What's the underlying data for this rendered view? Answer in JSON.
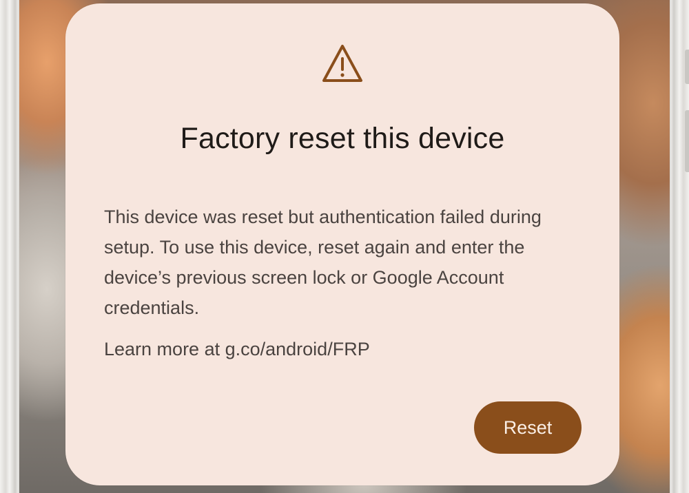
{
  "dialog": {
    "icon": "warning-triangle-icon",
    "title": "Factory reset this device",
    "message": "This device was reset but authentication failed during setup. To use this device, reset again and enter the device’s previous screen lock or Google Account credentials.",
    "learn_more": "Learn more at g.co/android/FRP",
    "reset_label": "Reset"
  },
  "colors": {
    "dialog_background": "#f7e6de",
    "accent": "#8a4e1b",
    "button_text": "#fbefe6",
    "title_text": "#1f1b18",
    "body_text": "#4a4340"
  }
}
